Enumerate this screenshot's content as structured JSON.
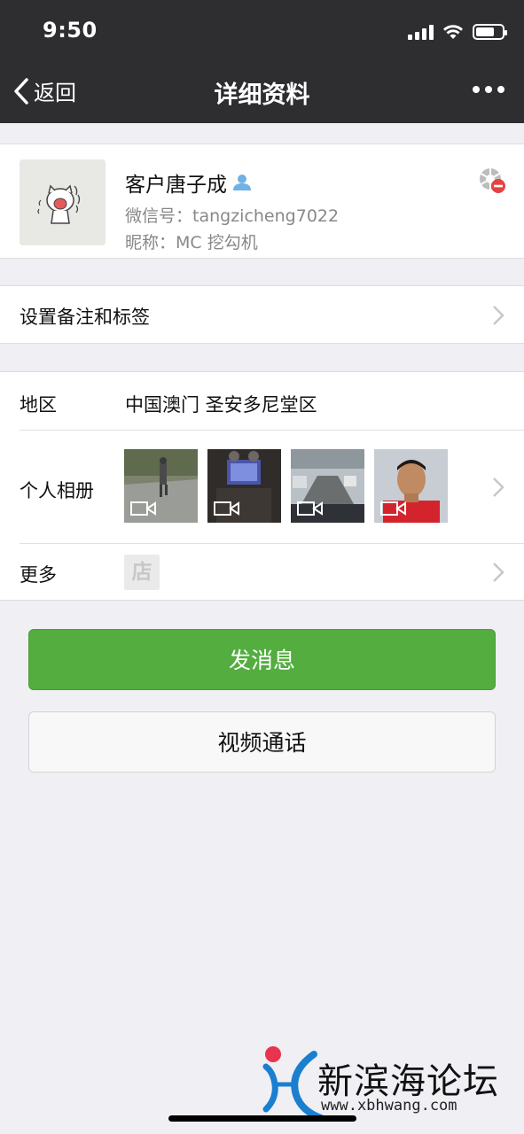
{
  "status_bar": {
    "time": "9:50",
    "icons": [
      "signal-icon",
      "wifi-icon",
      "battery-icon"
    ],
    "battery_level": 0.7
  },
  "nav": {
    "back_label": "返回",
    "title": "详细资料",
    "more_icon": "more-dots-icon"
  },
  "profile": {
    "name": "客户唐子成",
    "wechat_id": "微信号：tangzicheng7022",
    "nickname": "昵称：MC 挖勾机",
    "contact_badge_icon": "contact-person-icon",
    "privacy_icon": "moments-blocked-icon"
  },
  "remark_row": {
    "label": "设置备注和标签"
  },
  "region_row": {
    "label": "地区",
    "value": "中国澳门 圣安多尼堂区"
  },
  "album_row": {
    "label": "个人相册",
    "thumbs": [
      {
        "type": "video",
        "icon": "video-camera-icon"
      },
      {
        "type": "video",
        "icon": "video-camera-icon"
      },
      {
        "type": "video",
        "icon": "video-camera-icon"
      },
      {
        "type": "video",
        "icon": "video-camera-icon"
      }
    ]
  },
  "more_row": {
    "label": "更多",
    "shop_glyph": "店"
  },
  "buttons": {
    "send_message": "发消息",
    "video_call": "视频通话"
  },
  "colors": {
    "nav_bg": "#2e2e31",
    "page_bg": "#efeff4",
    "primary_green": "#53ad3f",
    "watermark_red": "#e8344e",
    "watermark_blue": "#1b7fd0"
  },
  "watermark": {
    "text": "新滨海论坛",
    "url": "www.xbhwang.com"
  }
}
